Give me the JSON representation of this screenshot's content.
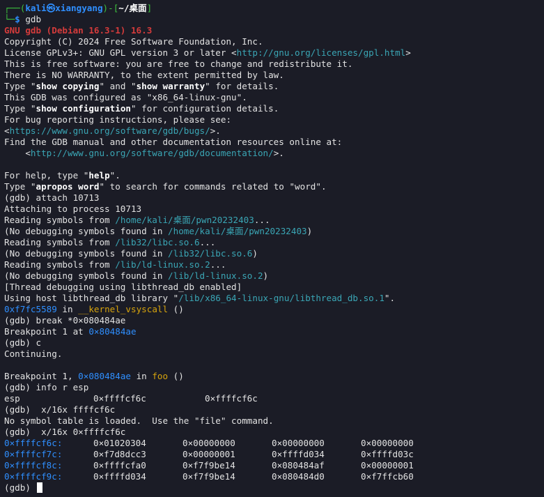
{
  "prompt": {
    "top_prefix": "┌──(",
    "user": "kali",
    "at_symbol": "㉿",
    "host": "xiangyang",
    "mid": ")-[",
    "path": "~/桌面",
    "end": "]",
    "bottom_prefix": "└─",
    "dollar": "$",
    "command": " gdb"
  },
  "banner": {
    "version": "GNU gdb (Debian 16.3-1) 16.3",
    "copyright": "Copyright (C) 2024 Free Software Foundation, Inc.",
    "license_pre": "License GPLv3+: GNU GPL version 3 or later <",
    "license_url": "http://gnu.org/licenses/gpl.html",
    "license_post": ">",
    "free_sw": "This is free software: you are free to change and redistribute it.",
    "no_warranty": "There is NO WARRANTY, to the extent permitted by law.",
    "type1_pre": "Type \"",
    "show_copying": "show copying",
    "type1_mid": "\" and \"",
    "show_warranty": "show warranty",
    "type1_post": "\" for details.",
    "configured": "This GDB was configured as \"x86_64-linux-gnu\".",
    "type2_pre": "Type \"",
    "show_configuration": "show configuration",
    "type2_post": "\" for configuration details.",
    "bug_reporting": "For bug reporting instructions, please see:",
    "bugs_pre": "<",
    "bugs_url": "https://www.gnu.org/software/gdb/bugs/",
    "bugs_post": ">.",
    "find_manual": "Find the GDB manual and other documentation resources online at:",
    "doc_pre": "    <",
    "doc_url": "http://www.gnu.org/software/gdb/documentation/",
    "doc_post": ">.",
    "help_pre": "For help, type \"",
    "help_word": "help",
    "help_post": "\".",
    "apropos_pre": "Type \"",
    "apropos_word": "apropos word",
    "apropos_post": "\" to search for commands related to \"word\"."
  },
  "session": {
    "attach_cmd": "(gdb) attach 10713",
    "attaching": "Attaching to process 10713",
    "reading1_pre": "Reading symbols from ",
    "reading1_path": "/home/kali/桌面/pwn20232403",
    "reading1_post": "...",
    "nodebug1_pre": "(No debugging symbols found in ",
    "nodebug1_path": "/home/kali/桌面/pwn20232403",
    "nodebug1_post": ")",
    "reading2_pre": "Reading symbols from ",
    "reading2_path": "/lib32/libc.so.6",
    "reading2_post": "...",
    "nodebug2_pre": "(No debugging symbols found in ",
    "nodebug2_path": "/lib32/libc.so.6",
    "nodebug2_post": ")",
    "reading3_pre": "Reading symbols from ",
    "reading3_path": "/lib/ld-linux.so.2",
    "reading3_post": "...",
    "nodebug3_pre": "(No debugging symbols found in ",
    "nodebug3_path": "/lib/ld-linux.so.2",
    "nodebug3_post": ")",
    "thread_debug": "[Thread debugging using libthread_db enabled]",
    "host_lib_pre": "Using host libthread_db library \"",
    "host_lib_path": "/lib/x86_64-linux-gnu/libthread_db.so.1",
    "host_lib_post": "\".",
    "stop_addr": "0xf7fc5589",
    "stop_in": " in ",
    "stop_func": "__kernel_vsyscall",
    "stop_args": " ()",
    "break_cmd": "(gdb) break *0×080484ae",
    "bp_set_pre": "Breakpoint 1 at ",
    "bp_set_addr": "0×80484ae",
    "continue_cmd": "(gdb) c",
    "continuing": "Continuing.",
    "bp_hit_pre": "Breakpoint 1, ",
    "bp_hit_addr": "0×080484ae",
    "bp_hit_in": " in ",
    "bp_hit_func": "foo",
    "bp_hit_args": " ()",
    "info_cmd": "(gdb) info r esp",
    "esp_name": "esp",
    "esp_hex": "0×ffffcf6c",
    "esp_val": "0×ffffcf6c",
    "x_cmd_bad": "(gdb)  x/16x ffffcf6c",
    "no_symbol": "No symbol table is loaded.  Use the \"file\" command.",
    "x_cmd": "(gdb)  x/16x 0×ffffcf6c",
    "final_prompt": "(gdb) "
  },
  "memory_dump": [
    {
      "addr": "0×ffffcf6c:",
      "words": [
        "0×01020304",
        "0×00000000",
        "0×00000000",
        "0×00000000"
      ]
    },
    {
      "addr": "0×ffffcf7c:",
      "words": [
        "0×f7d8dcc3",
        "0×00000001",
        "0×ffffd034",
        "0×ffffd03c"
      ]
    },
    {
      "addr": "0×ffffcf8c:",
      "words": [
        "0×ffffcfa0",
        "0×f7f9be14",
        "0×080484af",
        "0×00000001"
      ]
    },
    {
      "addr": "0×ffffcf9c:",
      "words": [
        "0×ffffd034",
        "0×f7f9be14",
        "0×080484d0",
        "0×f7ffcb60"
      ]
    }
  ],
  "colors": {
    "background": "#1b1c26",
    "foreground": "#e3e3e3",
    "prompt_blue": "#2f8fff",
    "prompt_green": "#3ec43e",
    "gdb_red": "#d43b3b",
    "path_cyan": "#3aa6b5",
    "function_yellow": "#d7a40d"
  }
}
